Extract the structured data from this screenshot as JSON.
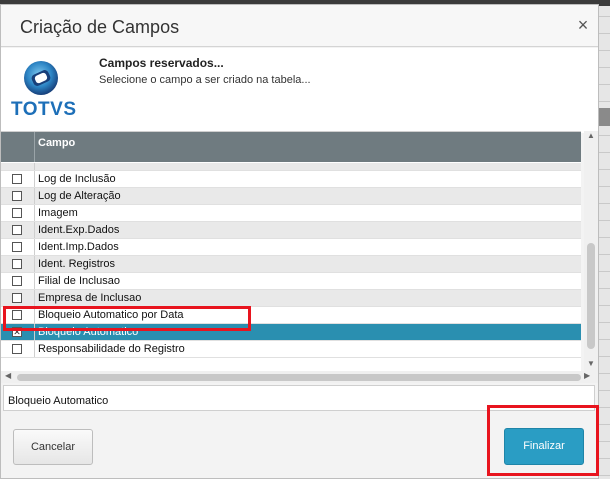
{
  "dialog": {
    "title": "Criação de Campos",
    "close_glyph": "×"
  },
  "header": {
    "logo_text": "TOTVS",
    "title": "Campos reservados...",
    "subtitle": "Selecione o campo a ser criado na tabela..."
  },
  "grid": {
    "column_header": "Campo",
    "rows": [
      {
        "label": "Log de Inclusão",
        "checked": false
      },
      {
        "label": "Log de Alteração",
        "checked": false
      },
      {
        "label": "Imagem",
        "checked": false
      },
      {
        "label": "Ident.Exp.Dados",
        "checked": false
      },
      {
        "label": "Ident.Imp.Dados",
        "checked": false
      },
      {
        "label": "Ident. Registros",
        "checked": false
      },
      {
        "label": "Filial de Inclusao",
        "checked": false
      },
      {
        "label": "Empresa de Inclusao",
        "checked": false
      },
      {
        "label": "Bloqueio Automatico por Data",
        "checked": false
      },
      {
        "label": "Bloqueio Automatico",
        "checked": true,
        "selected": true
      },
      {
        "label": "Responsabilidade do Registro",
        "checked": false
      }
    ]
  },
  "selected_value": "Bloqueio Automatico",
  "buttons": {
    "cancel": "Cancelar",
    "finish": "Finalizar"
  },
  "colors": {
    "selection": "#2a8fb0",
    "primary_button": "#2a9dc4",
    "header_bg": "#6f7b80",
    "highlight_box": "#e8141e"
  }
}
